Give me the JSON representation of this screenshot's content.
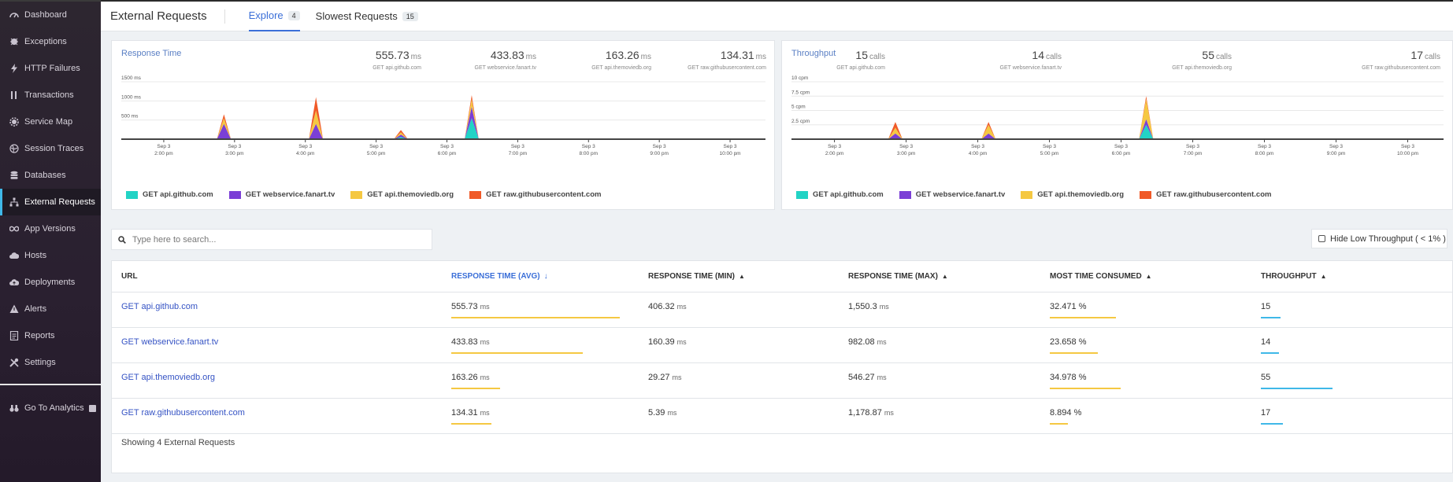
{
  "sidebar": {
    "items": [
      {
        "label": "Dashboard",
        "icon": "gauge-icon"
      },
      {
        "label": "Exceptions",
        "icon": "bug-icon"
      },
      {
        "label": "HTTP Failures",
        "icon": "bolt-icon"
      },
      {
        "label": "Transactions",
        "icon": "bars-icon"
      },
      {
        "label": "Service Map",
        "icon": "gear-icon"
      },
      {
        "label": "Session Traces",
        "icon": "globe-icon"
      },
      {
        "label": "Databases",
        "icon": "database-icon"
      },
      {
        "label": "External Requests",
        "icon": "sitemap-icon"
      },
      {
        "label": "App Versions",
        "icon": "infinity-icon"
      },
      {
        "label": "Hosts",
        "icon": "cloud-icon"
      },
      {
        "label": "Deployments",
        "icon": "cloud-upload-icon"
      },
      {
        "label": "Alerts",
        "icon": "warning-icon"
      },
      {
        "label": "Reports",
        "icon": "report-icon"
      },
      {
        "label": "Settings",
        "icon": "tools-icon"
      }
    ],
    "analytics": {
      "label": "Go To Analytics",
      "icon": "binoculars-icon"
    },
    "active_color": "#3fb8e8"
  },
  "header": {
    "title": "External Requests",
    "tabs": [
      {
        "label": "Explore",
        "count": "4"
      },
      {
        "label": "Slowest Requests",
        "count": "15"
      }
    ]
  },
  "colors": {
    "api_github": "#22d3c5",
    "fanart": "#7b3fd6",
    "themoviedb": "#f5c842",
    "githubusercontent": "#f05a28",
    "accent": "#3b6fd8"
  },
  "response_panel": {
    "title": "Response Time",
    "stats": [
      {
        "value": "555.73",
        "unit": "ms",
        "name": "GET api.github.com"
      },
      {
        "value": "433.83",
        "unit": "ms",
        "name": "GET webservice.fanart.tv"
      },
      {
        "value": "163.26",
        "unit": "ms",
        "name": "GET api.themoviedb.org"
      },
      {
        "value": "134.31",
        "unit": "ms",
        "name": "GET raw.githubusercontent.com"
      }
    ]
  },
  "throughput_panel": {
    "title": "Throughput",
    "stats": [
      {
        "value": "15",
        "unit": "calls",
        "name": "GET api.github.com"
      },
      {
        "value": "14",
        "unit": "calls",
        "name": "GET webservice.fanart.tv"
      },
      {
        "value": "55",
        "unit": "calls",
        "name": "GET api.themoviedb.org"
      },
      {
        "value": "17",
        "unit": "calls",
        "name": "GET raw.githubusercontent.com"
      }
    ]
  },
  "legend": [
    "GET api.github.com",
    "GET webservice.fanart.tv",
    "GET api.themoviedb.org",
    "GET raw.githubusercontent.com"
  ],
  "chart_data": [
    {
      "type": "area",
      "title": "Response Time",
      "x_ticks": [
        [
          "Sep 3",
          "2:00 pm"
        ],
        [
          "Sep 3",
          "3:00 pm"
        ],
        [
          "Sep 3",
          "4:00 pm"
        ],
        [
          "Sep 3",
          "5:00 pm"
        ],
        [
          "Sep 3",
          "6:00 pm"
        ],
        [
          "Sep 3",
          "7:00 pm"
        ],
        [
          "Sep 3",
          "8:00 pm"
        ],
        [
          "Sep 3",
          "9:00 pm"
        ],
        [
          "Sep 3",
          "10:00 pm"
        ]
      ],
      "y_ticks": [
        "500 ms",
        "1000 ms",
        "1500 ms"
      ],
      "ylim": [
        0,
        1500
      ],
      "x_hours": [
        13.4,
        22.5
      ],
      "stacked": true,
      "peaks": [
        {
          "t": 14.85,
          "values": [
            0,
            400,
            150,
            100
          ]
        },
        {
          "t": 16.15,
          "values": [
            0,
            400,
            350,
            350
          ]
        },
        {
          "t": 17.35,
          "values": [
            60,
            60,
            60,
            60
          ]
        },
        {
          "t": 18.35,
          "values": [
            550,
            300,
            200,
            100
          ]
        }
      ],
      "series": [
        {
          "name": "GET api.github.com"
        },
        {
          "name": "GET webservice.fanart.tv"
        },
        {
          "name": "GET api.themoviedb.org"
        },
        {
          "name": "GET raw.githubusercontent.com"
        }
      ],
      "legend": "bottom-left",
      "grid": true
    },
    {
      "type": "area",
      "title": "Throughput",
      "x_ticks": [
        [
          "Sep 3",
          "2:00 pm"
        ],
        [
          "Sep 3",
          "3:00 pm"
        ],
        [
          "Sep 3",
          "4:00 pm"
        ],
        [
          "Sep 3",
          "5:00 pm"
        ],
        [
          "Sep 3",
          "6:00 pm"
        ],
        [
          "Sep 3",
          "7:00 pm"
        ],
        [
          "Sep 3",
          "8:00 pm"
        ],
        [
          "Sep 3",
          "9:00 pm"
        ],
        [
          "Sep 3",
          "10:00 pm"
        ]
      ],
      "y_ticks": [
        "2.5 cpm",
        "5 cpm",
        "7.5 cpm",
        "10 cpm"
      ],
      "ylim": [
        0,
        10
      ],
      "x_hours": [
        13.4,
        22.5
      ],
      "stacked": true,
      "peaks": [
        {
          "t": 14.85,
          "values": [
            0,
            1.0,
            1.0,
            1.0
          ]
        },
        {
          "t": 16.15,
          "values": [
            0,
            1.0,
            1.5,
            0.5
          ]
        },
        {
          "t": 18.35,
          "values": [
            2.5,
            1.0,
            3.5,
            0.5
          ]
        }
      ],
      "series": [
        {
          "name": "GET api.github.com"
        },
        {
          "name": "GET webservice.fanart.tv"
        },
        {
          "name": "GET api.themoviedb.org"
        },
        {
          "name": "GET raw.githubusercontent.com"
        }
      ],
      "legend": "bottom-left",
      "grid": true
    }
  ],
  "search": {
    "placeholder": "Type here to search..."
  },
  "filter": {
    "label": "Hide Low Throughput ( < 1% )"
  },
  "table": {
    "columns": [
      "URL",
      "RESPONSE TIME (AVG)",
      "RESPONSE TIME (MIN)",
      "RESPONSE TIME (MAX)",
      "MOST TIME CONSUMED",
      "THROUGHPUT"
    ],
    "rows": [
      {
        "url": "GET api.github.com",
        "avg": "555.73",
        "min": "406.32",
        "max": "1,550.3",
        "consumed": "32.471 %",
        "throughput": "15",
        "avg_frac": 1.0,
        "consumed_frac": 0.93,
        "throughput_frac": 0.27
      },
      {
        "url": "GET webservice.fanart.tv",
        "avg": "433.83",
        "min": "160.39",
        "max": "982.08",
        "consumed": "23.658 %",
        "throughput": "14",
        "avg_frac": 0.78,
        "consumed_frac": 0.68,
        "throughput_frac": 0.25
      },
      {
        "url": "GET api.themoviedb.org",
        "avg": "163.26",
        "min": "29.27",
        "max": "546.27",
        "consumed": "34.978 %",
        "throughput": "55",
        "avg_frac": 0.29,
        "consumed_frac": 1.0,
        "throughput_frac": 1.0
      },
      {
        "url": "GET raw.githubusercontent.com",
        "avg": "134.31",
        "min": "5.39",
        "max": "1,178.87",
        "consumed": "8.894 %",
        "throughput": "17",
        "avg_frac": 0.24,
        "consumed_frac": 0.25,
        "throughput_frac": 0.31
      }
    ],
    "unit": "ms",
    "footer": "Showing 4 External Requests"
  }
}
